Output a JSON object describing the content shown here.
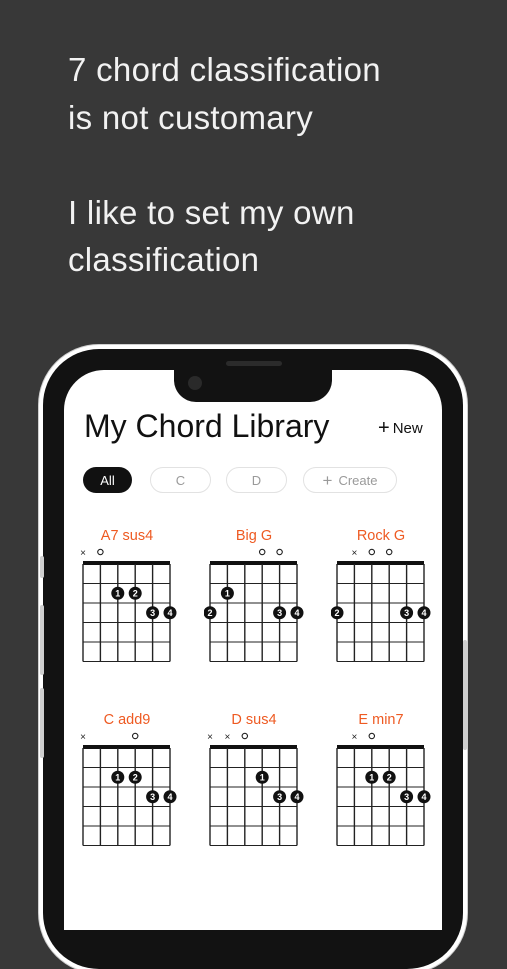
{
  "headline": {
    "line1": "7 chord classification",
    "line2": "is not customary",
    "line3": "I like to set my own",
    "line4": "classification"
  },
  "library": {
    "title": "My Chord Library",
    "new_label": "New",
    "new_icon": "plus-icon",
    "create_icon": "plus-icon",
    "accent_color": "#ee5a22"
  },
  "filters": [
    {
      "label": "All",
      "active": true
    },
    {
      "label": "C",
      "active": false
    },
    {
      "label": "D",
      "active": false
    },
    {
      "label": "Create",
      "active": false
    }
  ],
  "chords": [
    {
      "name": "A7 sus4",
      "markers": [
        "x",
        "o",
        "",
        "",
        "",
        ""
      ],
      "fingers": [
        {
          "string": 3,
          "fret": 2,
          "num": "1"
        },
        {
          "string": 4,
          "fret": 2,
          "num": "2"
        },
        {
          "string": 5,
          "fret": 3,
          "num": "3"
        },
        {
          "string": 6,
          "fret": 3,
          "num": "4"
        }
      ]
    },
    {
      "name": "Big G",
      "markers": [
        "",
        "",
        "",
        "o",
        "o",
        ""
      ],
      "fingers": [
        {
          "string": 2,
          "fret": 2,
          "num": "1"
        },
        {
          "string": 1,
          "fret": 3,
          "num": "2"
        },
        {
          "string": 5,
          "fret": 3,
          "num": "3"
        },
        {
          "string": 6,
          "fret": 3,
          "num": "4"
        }
      ]
    },
    {
      "name": "Rock G",
      "markers": [
        "",
        "x",
        "o",
        "o",
        "",
        ""
      ],
      "fingers": [
        {
          "string": 1,
          "fret": 3,
          "num": "2"
        },
        {
          "string": 5,
          "fret": 3,
          "num": "3"
        },
        {
          "string": 6,
          "fret": 3,
          "num": "4"
        }
      ]
    },
    {
      "name": "C add9",
      "markers": [
        "x",
        "",
        "",
        "o",
        "",
        ""
      ],
      "fingers": [
        {
          "string": 3,
          "fret": 2,
          "num": "1"
        },
        {
          "string": 4,
          "fret": 2,
          "num": "2"
        },
        {
          "string": 5,
          "fret": 3,
          "num": "3"
        },
        {
          "string": 6,
          "fret": 3,
          "num": "4"
        }
      ]
    },
    {
      "name": "D sus4",
      "markers": [
        "x",
        "x",
        "o",
        "",
        "",
        ""
      ],
      "fingers": [
        {
          "string": 4,
          "fret": 2,
          "num": "1"
        },
        {
          "string": 5,
          "fret": 3,
          "num": "3"
        },
        {
          "string": 6,
          "fret": 3,
          "num": "4"
        }
      ]
    },
    {
      "name": "E min7",
      "markers": [
        "",
        "x",
        "o",
        "",
        "",
        ""
      ],
      "fingers": [
        {
          "string": 3,
          "fret": 2,
          "num": "1"
        },
        {
          "string": 4,
          "fret": 2,
          "num": "2"
        },
        {
          "string": 5,
          "fret": 3,
          "num": "3"
        },
        {
          "string": 6,
          "fret": 3,
          "num": "4"
        }
      ]
    }
  ]
}
